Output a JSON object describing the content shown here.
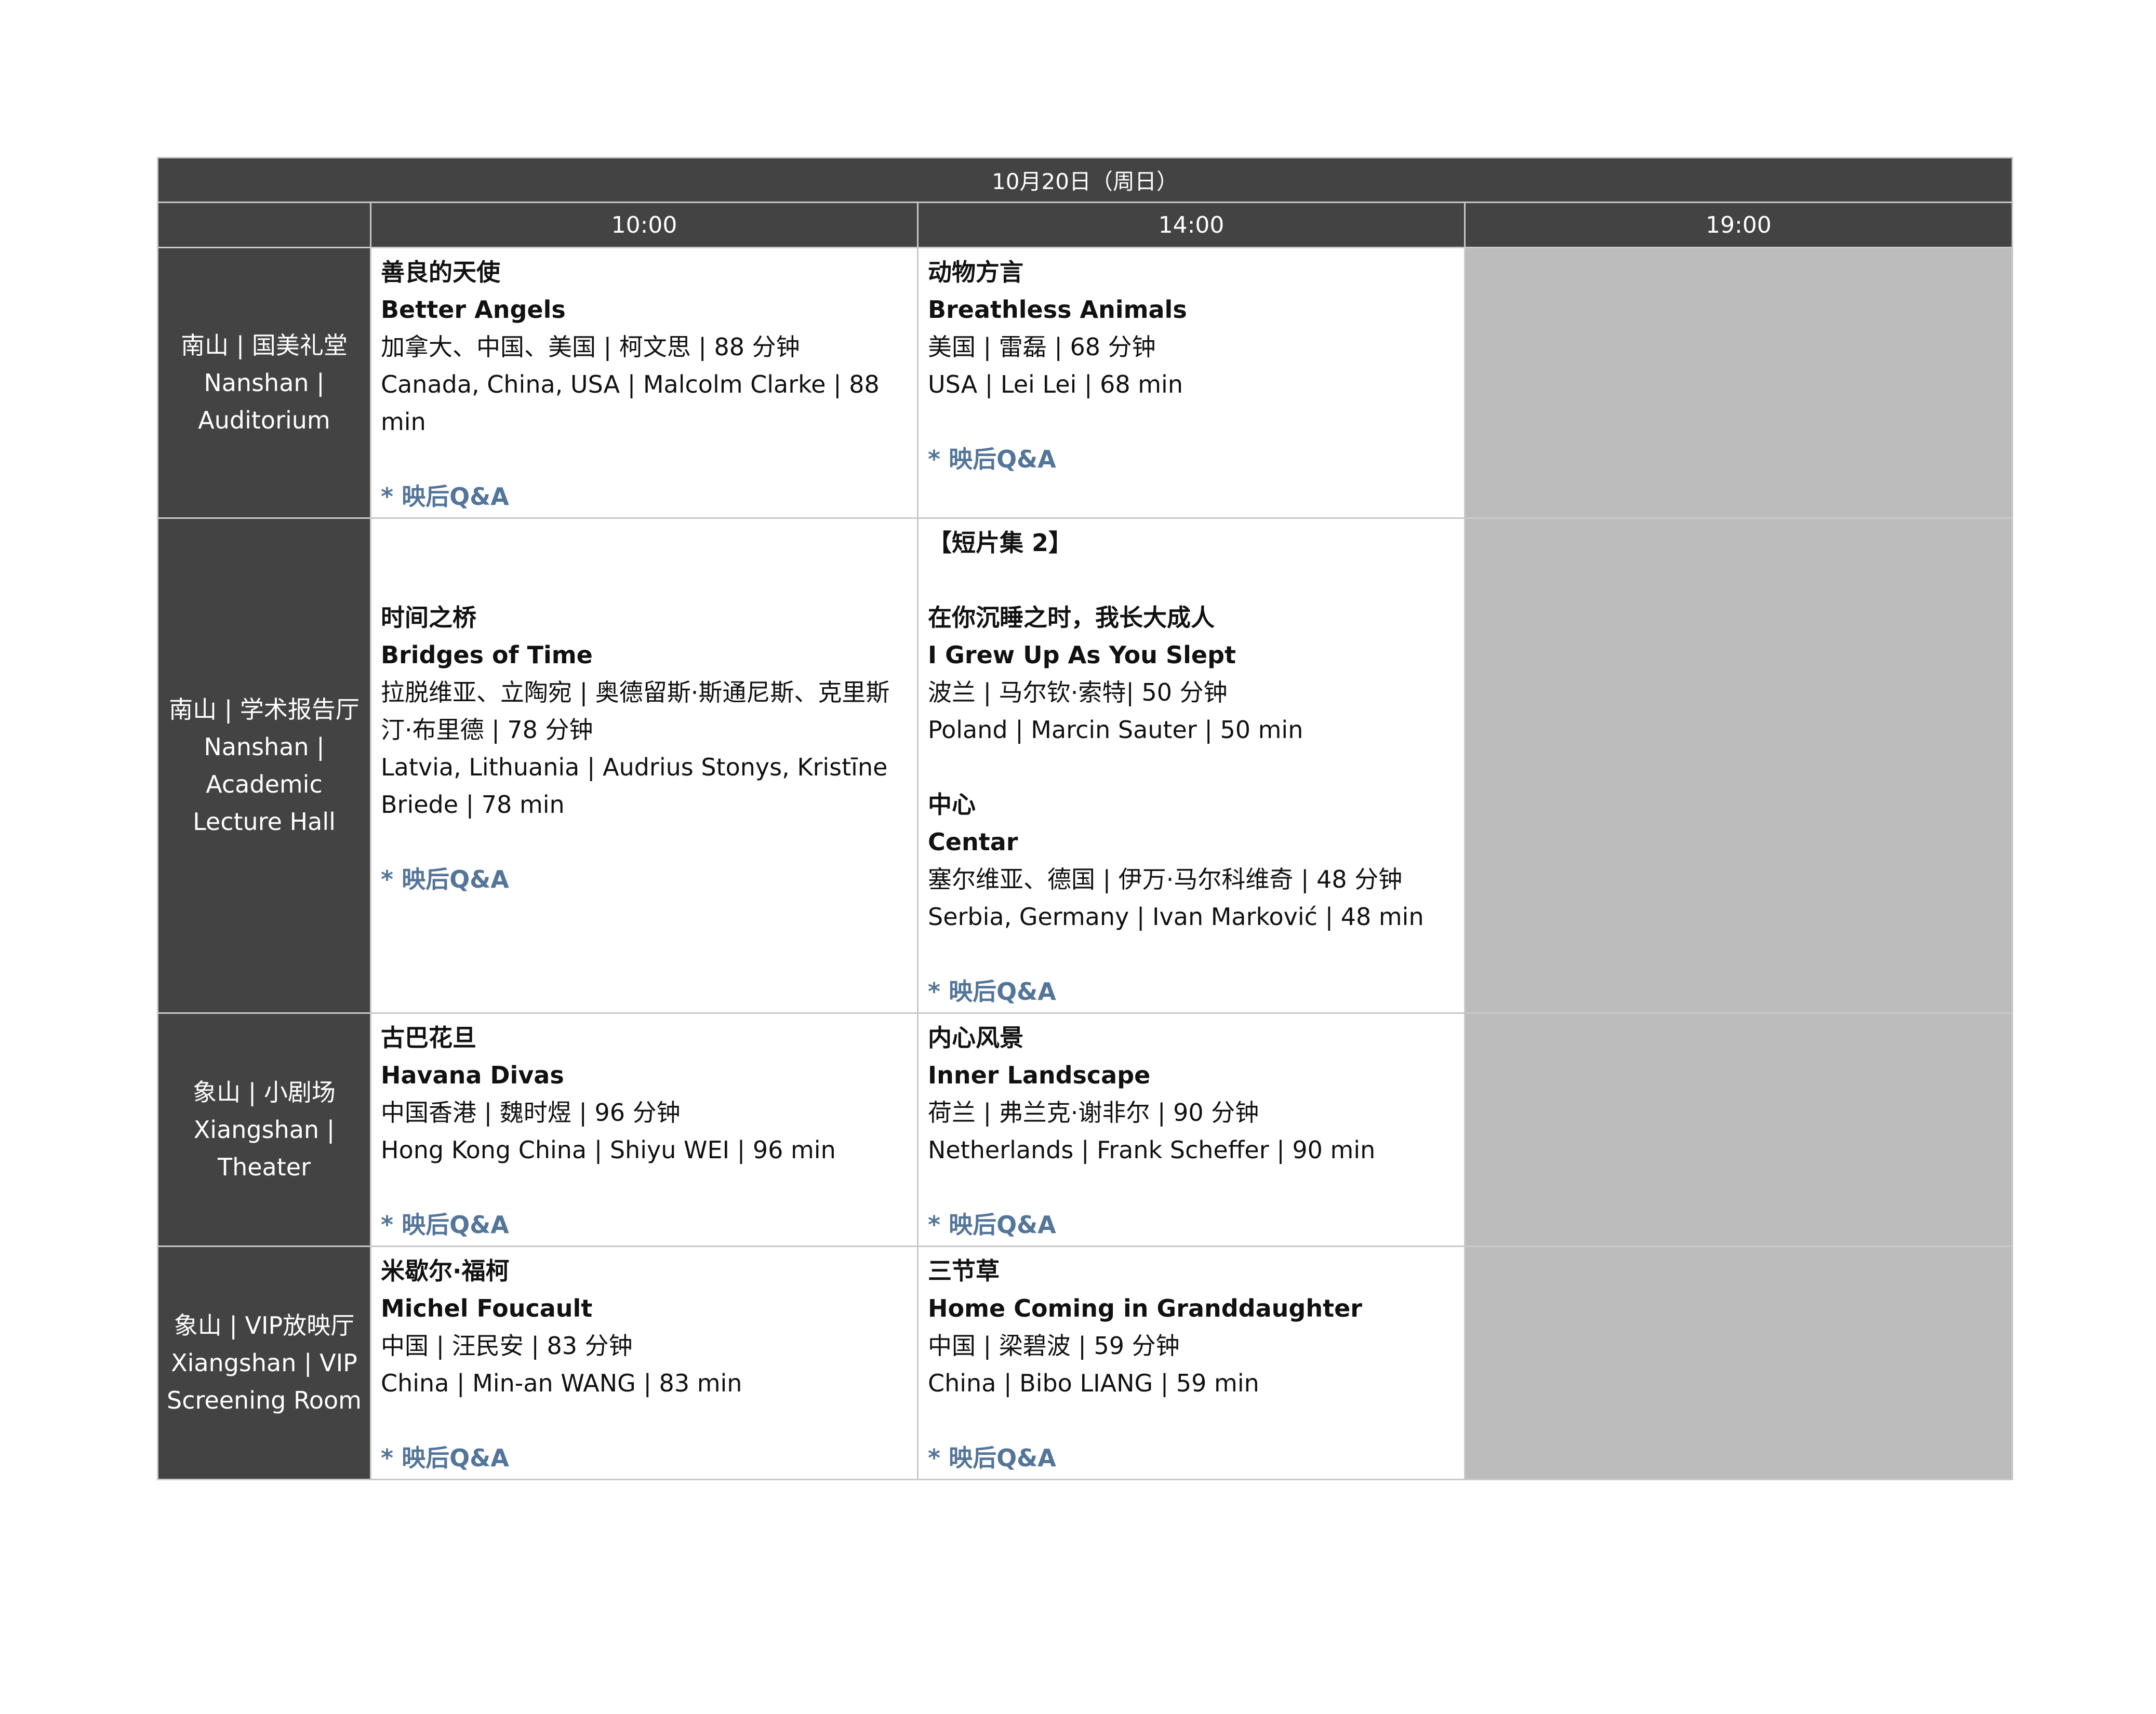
{
  "date_header": "10月20日（周日）",
  "time_slots": [
    "10:00",
    "14:00",
    "19:00"
  ],
  "qa_label": "* 映后Q&A",
  "venues": [
    {
      "zh": "南山 | 国美礼堂",
      "en_line1": "Nanshan |",
      "en_line2": "Auditorium",
      "en_line3": ""
    },
    {
      "zh": "南山 | 学术报告厅",
      "en_line1": "Nanshan |",
      "en_line2": "Academic",
      "en_line3": "Lecture Hall"
    },
    {
      "zh": "象山 | 小剧场",
      "en_line1": "Xiangshan |",
      "en_line2": "Theater",
      "en_line3": ""
    },
    {
      "zh": "象山 | VIP放映厅",
      "en_line1": "Xiangshan | VIP",
      "en_line2": "Screening Room",
      "en_line3": ""
    }
  ],
  "films": {
    "r1_1000": {
      "title_zh": "善良的天使",
      "title_en": "Better Angels",
      "info_zh": "加拿大、中国、美国 | 柯文思 | 88 分钟",
      "info_en": "Canada, China, USA | Malcolm Clarke | 88 min"
    },
    "r1_1400": {
      "title_zh": "动物方言",
      "title_en": "Breathless Animals",
      "info_zh": "美国 | 雷磊 | 68 分钟",
      "info_en": "USA | Lei Lei | 68 min"
    },
    "r2_1000": {
      "title_zh": "时间之桥",
      "title_en": "Bridges of Time",
      "info_zh": "拉脱维亚、立陶宛 | 奥德留斯·斯通尼斯、克里斯汀·布里德 | 78 分钟",
      "info_en": "Latvia, Lithuania | Audrius Stonys, Kristīne Briede | 78 min"
    },
    "r2_1400": {
      "program": "【短片集 2】",
      "a_title_zh": "在你沉睡之时，我长大成人",
      "a_title_en": "I Grew Up As You Slept",
      "a_info_zh": "波兰 | 马尔钦·索特| 50 分钟",
      "a_info_en": "Poland | Marcin Sauter | 50 min",
      "b_title_zh": "中心",
      "b_title_en": "Centar",
      "b_info_zh": "塞尔维亚、德国 | 伊万·马尔科维奇 | 48 分钟",
      "b_info_en": "Serbia, Germany | Ivan Marković | 48 min"
    },
    "r3_1000": {
      "title_zh": "古巴花旦",
      "title_en": "Havana Divas",
      "info_zh": "中国香港 | 魏时煜 | 96 分钟",
      "info_en": "Hong Kong China | Shiyu WEI | 96 min"
    },
    "r3_1400": {
      "title_zh": "内心风景",
      "title_en": "Inner Landscape",
      "info_zh": "荷兰 | 弗兰克·谢非尔 | 90 分钟",
      "info_en": "Netherlands | Frank Scheffer | 90 min"
    },
    "r4_1000": {
      "title_zh": "米歇尔·福柯",
      "title_en": "Michel Foucault",
      "info_zh": "中国 | 汪民安 | 83 分钟",
      "info_en": "China | Min-an WANG | 83 min"
    },
    "r4_1400": {
      "title_zh": "三节草",
      "title_en": "Home Coming in Granddaughter",
      "info_zh": "中国 | 梁碧波 | 59 分钟",
      "info_en": "China | Bibo LIANG | 59 min"
    }
  }
}
